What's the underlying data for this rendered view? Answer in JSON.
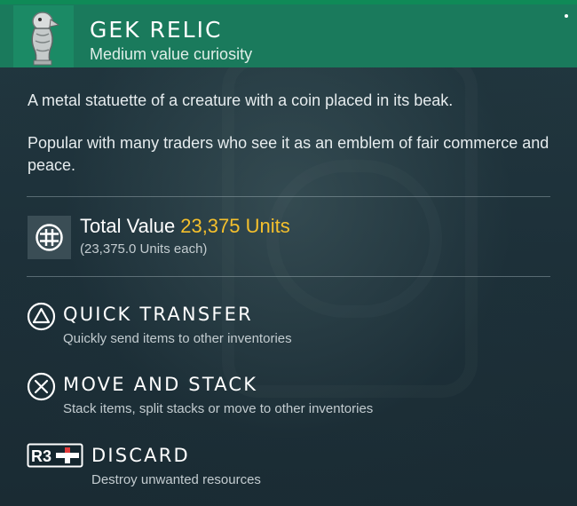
{
  "item": {
    "name": "GEK RELIC",
    "category": "Medium value curiosity",
    "description_1": "A metal statuette of a creature with a coin placed in its beak.",
    "description_2": "Popular with many traders who see it as an emblem of fair commerce and peace."
  },
  "value": {
    "label": "Total Value",
    "amount": "23,375 Units",
    "each": "(23,375.0 Units each)"
  },
  "actions": [
    {
      "button": "triangle",
      "title": "QUICK TRANSFER",
      "desc": "Quickly send items to other inventories"
    },
    {
      "button": "cross",
      "title": "MOVE AND STACK",
      "desc": "Stack items, split stacks or move to other inventories"
    },
    {
      "button": "R3",
      "title": "DISCARD",
      "desc": "Destroy unwanted resources"
    }
  ],
  "colors": {
    "header_bg": "#1a7a5c",
    "value_accent": "#f5c02c",
    "panel_bg": "#1d3039"
  },
  "icons": {
    "item": "gek-relic-statuette-icon",
    "currency": "units-currency-icon",
    "triangle": "triangle-button-icon",
    "cross": "cross-button-icon",
    "r3": "r3-button-icon"
  }
}
